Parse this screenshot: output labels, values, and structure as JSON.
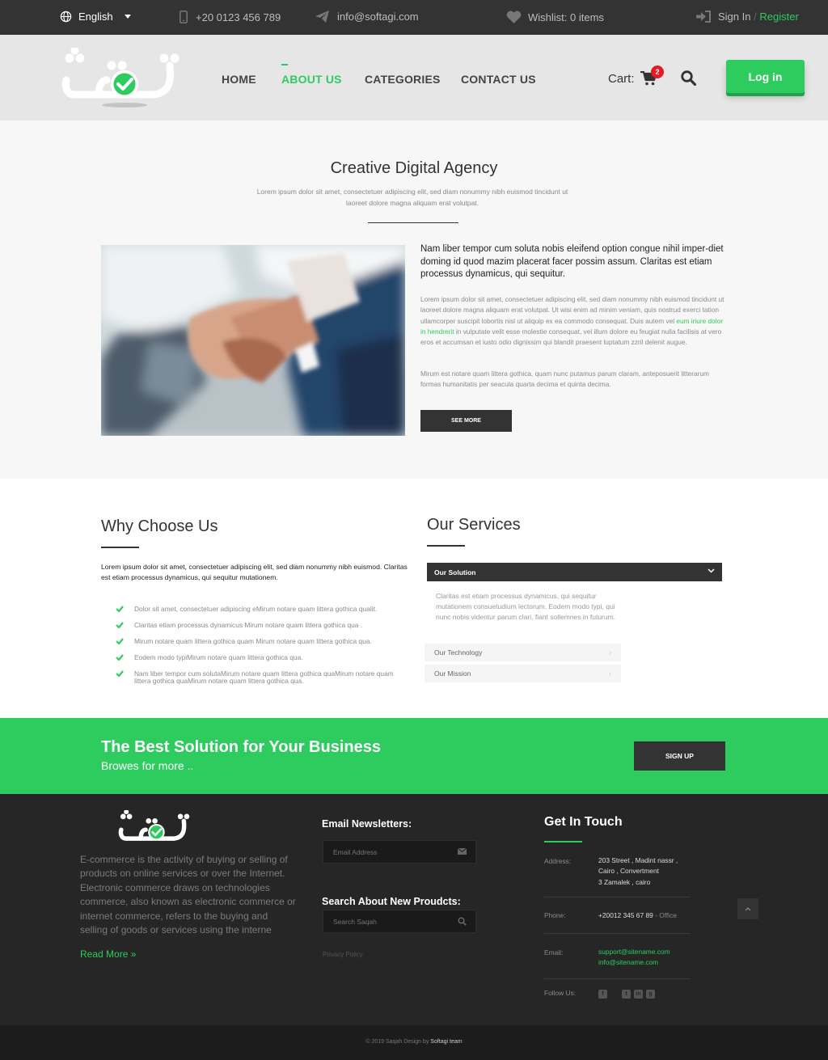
{
  "topbar": {
    "language": "English",
    "phone": "+20 0123 456 789",
    "email": "info@softagi.com",
    "wishlist": "Wishlist: 0 items",
    "signin": "Sign In",
    "separator": "/",
    "register": "Register"
  },
  "nav": {
    "items": [
      {
        "label": "HOME",
        "active": false
      },
      {
        "label": "ABOUT US",
        "active": true
      },
      {
        "label": "CATEGORIES",
        "active": false
      },
      {
        "label": "CONTACT US",
        "active": false
      }
    ],
    "cart_label": "Cart:",
    "cart_count": "2",
    "login_label": "Log in"
  },
  "about": {
    "title": "Creative Digital Agency",
    "subtitle": "Lorem ipsum dolor sit amet, consectetuer adipiscing elit, sed diam nonummy nibh euismod tincidunt ut laoreet dolore magna aliquam erat volutpat.",
    "lead": "Nam liber tempor cum soluta nobis eleifend option congue nihil imper-diet doming id quod mazim placerat facer possim assum. Claritas est etiam processus dynamicus, qui sequitur.",
    "body1_a": "Lorem ipsum dolor sit amet, consectetuer adipiscing elit, sed diam nonummy nibh euismod tincidunt ut laoreet dolore magna aliquam erat volutpat. Ut wisi enim ad minim veniam, quis nostrud exerci tation ullamcorper suscipit lobortis nisl ut aliquip ex ea commodo consequat. Duis autem vel ",
    "body1_link": "eum iriure dolor in hendrerit",
    "body1_b": " in vulputate velit esse molestie consequat, vel illum dolore eu feugiat nulla facilisis at vero eros et accumsan et iusto odio dignissim qui blandit praesent luptatum zzril delenit augue.",
    "body2": "Mirum est notare quam littera gothica, quam nunc putamus parum claram, anteposuerit litterarum formas humanitatis per seacula quarta decima et quinta decima.",
    "see_more": "SEE MORE"
  },
  "why": {
    "title": "Why Choose Us",
    "intro": "Lorem ipsum dolor sit amet, consectetuer adipiscing elit, sed diam nonummy nibh euismod. Claritas est etiam processus dynamicus, qui sequitur mutationem.",
    "items": [
      "Dolor sit amet, consectetuer adipiscing eMirum notare quam littera gothica qualit.",
      "Claritas etiam processus dynamicus Mirum notare quam littera gothica qua .",
      "Mirum notare quam littera gothica quam Mirum notare quam littera gothica qua.",
      "Eodem modo typiMirum notare quam littera gothica qua.",
      "Nam liber tempor cum solutaMirum notare quam littera gothica quaMirum notare quam littera gothica quaMirum notare quam littera gothica qua."
    ]
  },
  "services": {
    "title": "Our Services",
    "open_item": "Our Solution",
    "open_body": "Claritas est etiam processus dynamicus, qui sequitur mutationem consuetudium lectorum. Eodem modo typi, qui nunc nobis videntur parum clari, fiant sollemnes in futurum.",
    "items": [
      "Our Technology",
      "Our Mission"
    ],
    "chevron": "›"
  },
  "cta": {
    "title": "The Best Solution for Your Business",
    "subtitle": "Browes for more ..",
    "button": "SIGN UP"
  },
  "footer": {
    "description": "E-commerce is the activity of buying or selling of products on online services or over the Internet. Electronic commerce draws on technologies commerce, also known as electronic commerce or internet commerce, refers to the buying and selling of goods or services using the interne",
    "read_more": "Read More »",
    "newsletter_heading": "Email Newsletters:",
    "newsletter_placeholder": "Email Address",
    "search_heading": "Search About New Proudcts:",
    "search_placeholder": "Search Saqah",
    "privacy": "Privacy Policy",
    "git_title": "Get In Touch",
    "address_label": "Address:",
    "address_l1": "203 Street , Madint nassr ,",
    "address_l2": "Cairo , Convertment",
    "address_l3": "3 Zamalek , cairo",
    "phone_label": "Phone:",
    "phone_value": "+20012 345 67 89",
    "phone_suffix": " - Office",
    "email_label": "Email:",
    "email1": "support@sitename.com",
    "email2": "info@sitename.com",
    "follow_label": "Follow Us:",
    "social": [
      "f",
      "t",
      "in",
      "g"
    ],
    "copyright_a": "© 2019 Saqah Design by ",
    "copyright_b": "Softagi team"
  },
  "colors": {
    "accent": "#2ecc5f",
    "dark": "#333333",
    "footer_bg": "#262626"
  }
}
